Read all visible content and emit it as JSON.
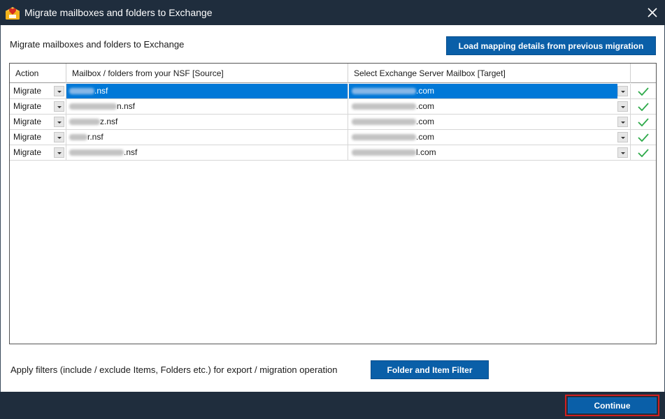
{
  "window": {
    "title": "Migrate mailboxes and folders to Exchange",
    "close_icon": "close-icon",
    "app_icon": "app-logo-icon"
  },
  "main": {
    "heading": "Migrate mailboxes and folders to Exchange",
    "load_button": "Load mapping details from previous migration"
  },
  "grid": {
    "columns": {
      "action": "Action",
      "source": "Mailbox / folders from your NSF [Source]",
      "target": "Select Exchange Server Mailbox [Target]",
      "status": ""
    },
    "rows": [
      {
        "action": "Migrate",
        "source_suffix": ".nsf",
        "target_suffix": ".com",
        "status_icon": "checkmark-icon",
        "selected": true
      },
      {
        "action": "Migrate",
        "source_suffix": "n.nsf",
        "target_suffix": ".com",
        "status_icon": "checkmark-icon",
        "selected": false
      },
      {
        "action": "Migrate",
        "source_suffix": "z.nsf",
        "target_suffix": ".com",
        "status_icon": "checkmark-icon",
        "selected": false
      },
      {
        "action": "Migrate",
        "source_suffix": "r.nsf",
        "target_suffix": ".com",
        "status_icon": "checkmark-icon",
        "selected": false
      },
      {
        "action": "Migrate",
        "source_suffix": ".nsf",
        "target_suffix": "l.com",
        "status_icon": "checkmark-icon",
        "selected": false
      }
    ]
  },
  "filters": {
    "label": "Apply filters (include / exclude Items, Folders etc.) for export / migration operation",
    "button": "Folder and Item Filter"
  },
  "footer": {
    "continue_button": "Continue"
  },
  "colors": {
    "titlebar": "#1f2d3d",
    "accent_button": "#0a5fa8",
    "selection": "#0078d7",
    "checkmark": "#2eaa4a",
    "highlight_border": "#d11f1f"
  }
}
